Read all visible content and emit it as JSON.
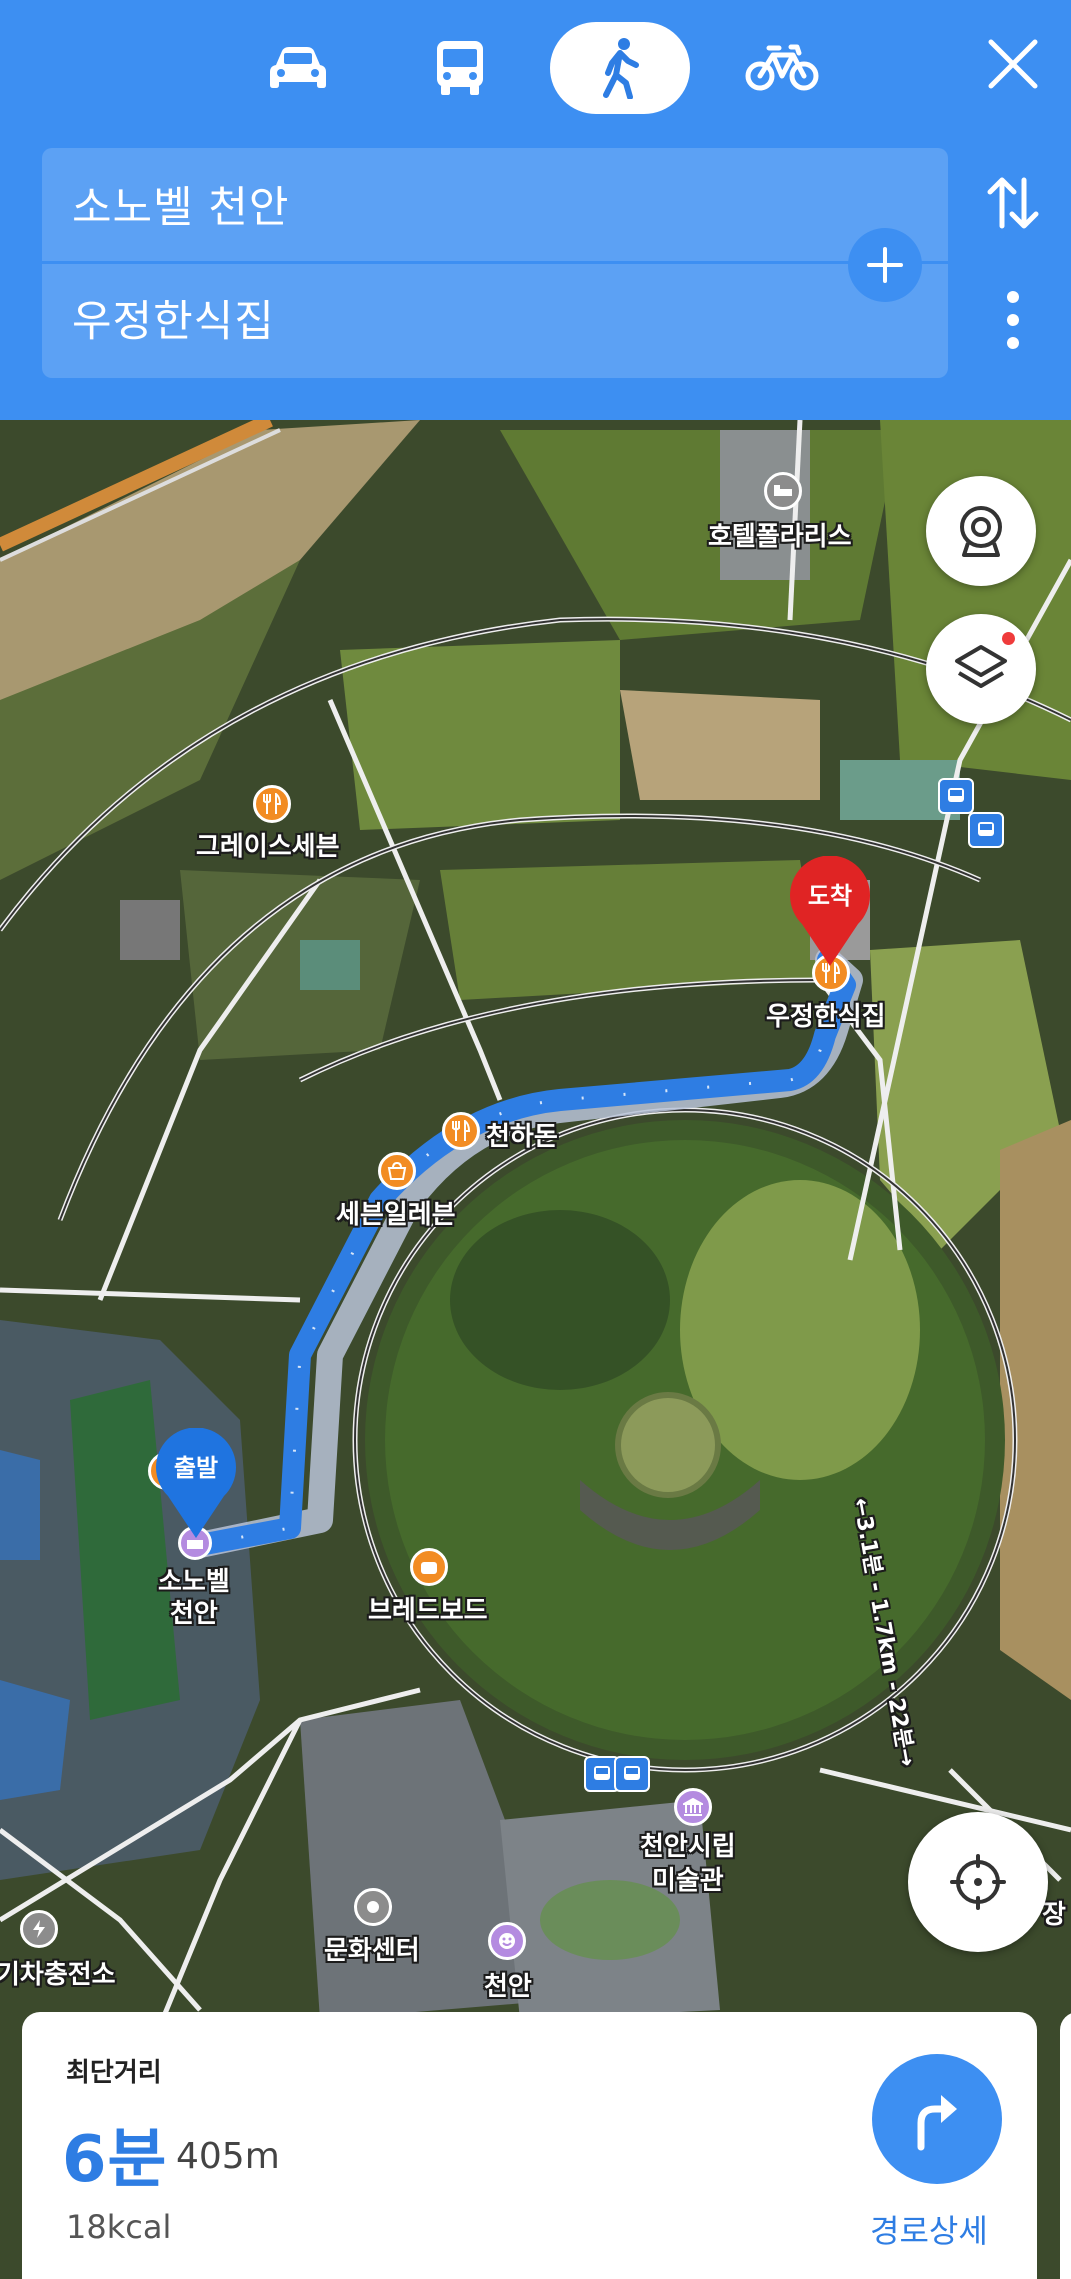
{
  "header": {
    "modes": [
      {
        "name": "car-icon",
        "active": false
      },
      {
        "name": "bus-icon",
        "active": false
      },
      {
        "name": "walk-icon",
        "active": true
      },
      {
        "name": "bicycle-icon",
        "active": false
      }
    ],
    "from": "소노벨 천안",
    "to": "우정한식집"
  },
  "map": {
    "places": {
      "hotel_polaris": "호텔폴라리스",
      "grace_seven": "그레이스세븐",
      "cheonhadon": "천하돈",
      "seven_eleven": "세븐일레븐",
      "breadboard": "브레드보드",
      "art_museum": "천안시립\n미술관",
      "culture_center": "문화센터",
      "cheonan": "천안",
      "ev_charging": "기차충전소",
      "sonobell_label": "소노벨\n천안",
      "destination_label": "우정한식집",
      "edge_partial": "장"
    },
    "start_pin": "출발",
    "end_pin": "도착",
    "trail_label": "←3.1분 - 1.7km - 22분→"
  },
  "summary": {
    "title": "최단거리",
    "time": "6분",
    "distance": "405m",
    "kcal": "18kcal",
    "detail": "경로상세"
  },
  "colors": {
    "header_bg": "#3d8ff2",
    "route_line": "#2e7de3",
    "end_pin": "#e02424",
    "start_pin": "#1f74e0"
  }
}
